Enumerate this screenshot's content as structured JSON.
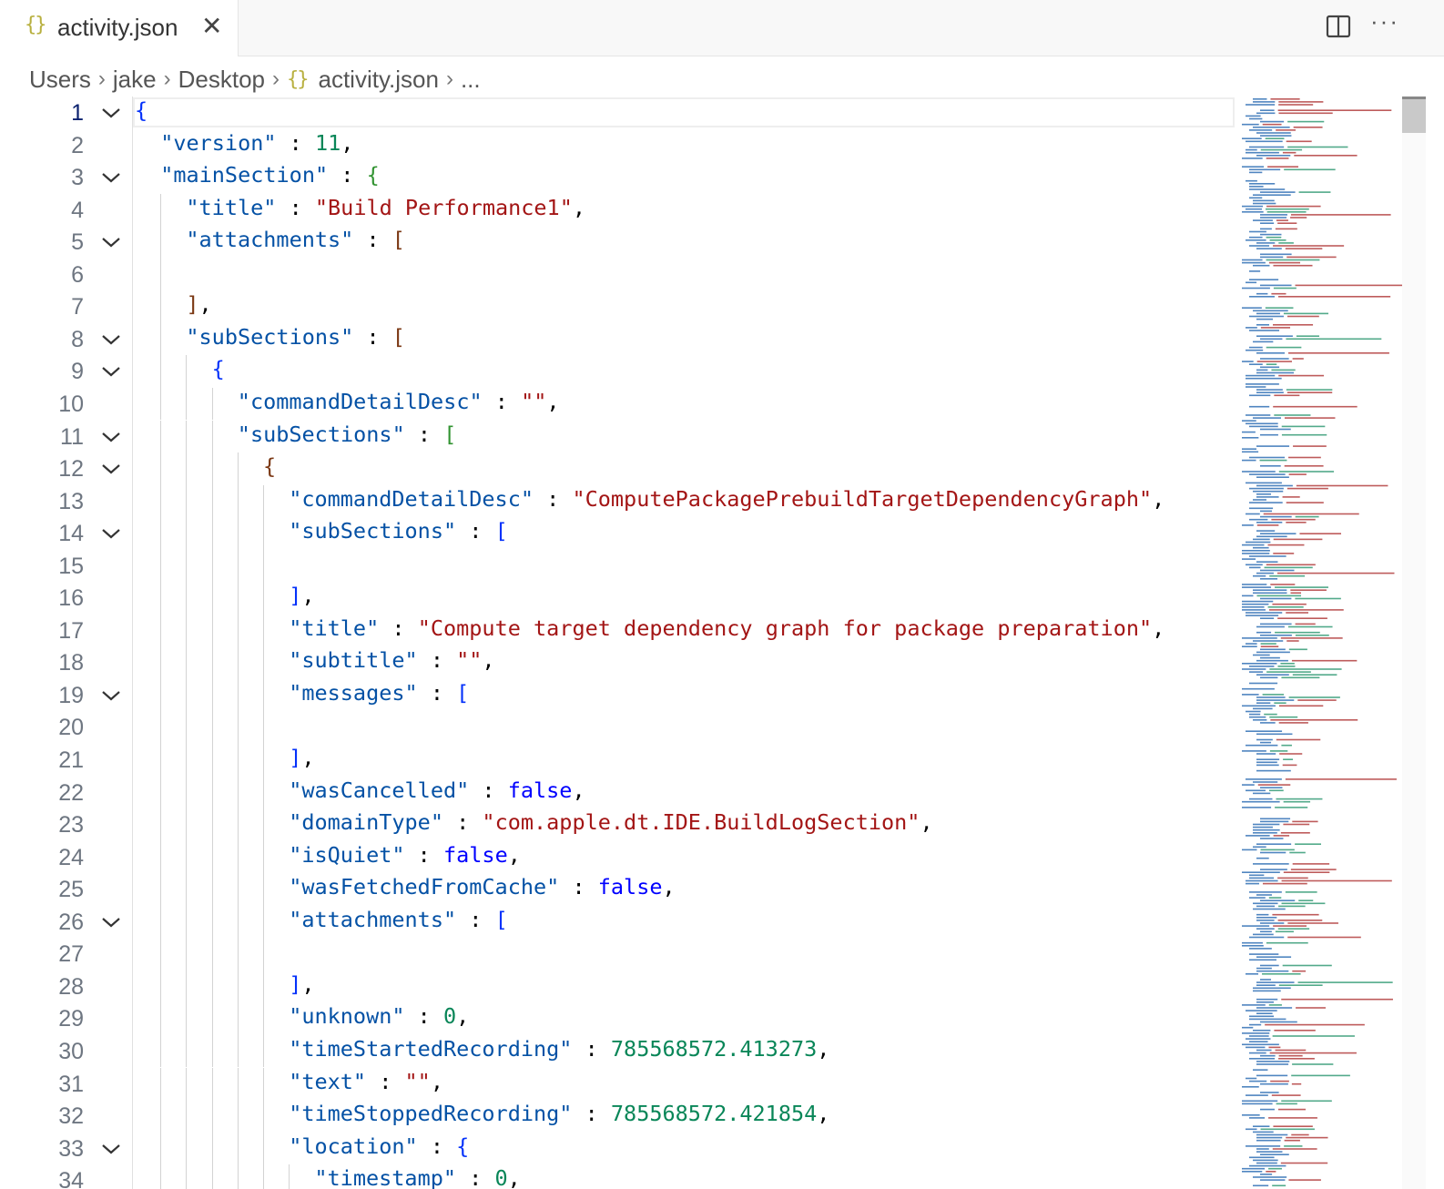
{
  "tab": {
    "label": "activity.json",
    "icon": "json-braces-icon"
  },
  "breadcrumb": {
    "items": [
      "Users",
      "jake",
      "Desktop",
      "activity.json",
      "..."
    ]
  },
  "editor": {
    "active_line": 1,
    "lines": [
      {
        "n": "1",
        "fold": true,
        "indent": 0,
        "tokens": [
          [
            "br1",
            "{"
          ]
        ]
      },
      {
        "n": "2",
        "fold": false,
        "indent": 1,
        "tokens": [
          [
            "k",
            "\"version\""
          ],
          [
            "p",
            " : "
          ],
          [
            "n",
            "11"
          ],
          [
            "p",
            ","
          ]
        ]
      },
      {
        "n": "3",
        "fold": true,
        "indent": 1,
        "tokens": [
          [
            "k",
            "\"mainSection\""
          ],
          [
            "p",
            " : "
          ],
          [
            "br2",
            "{"
          ]
        ]
      },
      {
        "n": "4",
        "fold": false,
        "indent": 2,
        "tokens": [
          [
            "k",
            "\"title\""
          ],
          [
            "p",
            " : "
          ],
          [
            "s",
            "\"Build Performance1\""
          ],
          [
            "p",
            ","
          ]
        ]
      },
      {
        "n": "5",
        "fold": true,
        "indent": 2,
        "tokens": [
          [
            "k",
            "\"attachments\""
          ],
          [
            "p",
            " : "
          ],
          [
            "br3",
            "["
          ]
        ]
      },
      {
        "n": "6",
        "fold": false,
        "indent": 2,
        "tokens": []
      },
      {
        "n": "7",
        "fold": false,
        "indent": 2,
        "tokens": [
          [
            "br3",
            "]"
          ],
          [
            "p",
            ","
          ]
        ]
      },
      {
        "n": "8",
        "fold": true,
        "indent": 2,
        "tokens": [
          [
            "k",
            "\"subSections\""
          ],
          [
            "p",
            " : "
          ],
          [
            "br3",
            "["
          ]
        ]
      },
      {
        "n": "9",
        "fold": true,
        "indent": 3,
        "tokens": [
          [
            "br1",
            "{"
          ]
        ]
      },
      {
        "n": "10",
        "fold": false,
        "indent": 4,
        "tokens": [
          [
            "k",
            "\"commandDetailDesc\""
          ],
          [
            "p",
            " : "
          ],
          [
            "s",
            "\"\""
          ],
          [
            "p",
            ","
          ]
        ]
      },
      {
        "n": "11",
        "fold": true,
        "indent": 4,
        "tokens": [
          [
            "k",
            "\"subSections\""
          ],
          [
            "p",
            " : "
          ],
          [
            "br2",
            "["
          ]
        ]
      },
      {
        "n": "12",
        "fold": true,
        "indent": 5,
        "tokens": [
          [
            "br3",
            "{"
          ]
        ]
      },
      {
        "n": "13",
        "fold": false,
        "indent": 6,
        "tokens": [
          [
            "k",
            "\"commandDetailDesc\""
          ],
          [
            "p",
            " : "
          ],
          [
            "s",
            "\"ComputePackagePrebuildTargetDependencyGraph\""
          ],
          [
            "p",
            ","
          ]
        ]
      },
      {
        "n": "14",
        "fold": true,
        "indent": 6,
        "tokens": [
          [
            "k",
            "\"subSections\""
          ],
          [
            "p",
            " : "
          ],
          [
            "br1",
            "["
          ]
        ]
      },
      {
        "n": "15",
        "fold": false,
        "indent": 6,
        "tokens": []
      },
      {
        "n": "16",
        "fold": false,
        "indent": 6,
        "tokens": [
          [
            "br1",
            "]"
          ],
          [
            "p",
            ","
          ]
        ]
      },
      {
        "n": "17",
        "fold": false,
        "indent": 6,
        "tokens": [
          [
            "k",
            "\"title\""
          ],
          [
            "p",
            " : "
          ],
          [
            "s",
            "\"Compute target dependency graph for package preparation\""
          ],
          [
            "p",
            ","
          ]
        ]
      },
      {
        "n": "18",
        "fold": false,
        "indent": 6,
        "tokens": [
          [
            "k",
            "\"subtitle\""
          ],
          [
            "p",
            " : "
          ],
          [
            "s",
            "\"\""
          ],
          [
            "p",
            ","
          ]
        ]
      },
      {
        "n": "19",
        "fold": true,
        "indent": 6,
        "tokens": [
          [
            "k",
            "\"messages\""
          ],
          [
            "p",
            " : "
          ],
          [
            "br1",
            "["
          ]
        ]
      },
      {
        "n": "20",
        "fold": false,
        "indent": 6,
        "tokens": []
      },
      {
        "n": "21",
        "fold": false,
        "indent": 6,
        "tokens": [
          [
            "br1",
            "]"
          ],
          [
            "p",
            ","
          ]
        ]
      },
      {
        "n": "22",
        "fold": false,
        "indent": 6,
        "tokens": [
          [
            "k",
            "\"wasCancelled\""
          ],
          [
            "p",
            " : "
          ],
          [
            "b",
            "false"
          ],
          [
            "p",
            ","
          ]
        ]
      },
      {
        "n": "23",
        "fold": false,
        "indent": 6,
        "tokens": [
          [
            "k",
            "\"domainType\""
          ],
          [
            "p",
            " : "
          ],
          [
            "s",
            "\"com.apple.dt.IDE.BuildLogSection\""
          ],
          [
            "p",
            ","
          ]
        ]
      },
      {
        "n": "24",
        "fold": false,
        "indent": 6,
        "tokens": [
          [
            "k",
            "\"isQuiet\""
          ],
          [
            "p",
            " : "
          ],
          [
            "b",
            "false"
          ],
          [
            "p",
            ","
          ]
        ]
      },
      {
        "n": "25",
        "fold": false,
        "indent": 6,
        "tokens": [
          [
            "k",
            "\"wasFetchedFromCache\""
          ],
          [
            "p",
            " : "
          ],
          [
            "b",
            "false"
          ],
          [
            "p",
            ","
          ]
        ]
      },
      {
        "n": "26",
        "fold": true,
        "indent": 6,
        "tokens": [
          [
            "k",
            "\"attachments\""
          ],
          [
            "p",
            " : "
          ],
          [
            "br1",
            "["
          ]
        ]
      },
      {
        "n": "27",
        "fold": false,
        "indent": 6,
        "tokens": []
      },
      {
        "n": "28",
        "fold": false,
        "indent": 6,
        "tokens": [
          [
            "br1",
            "]"
          ],
          [
            "p",
            ","
          ]
        ]
      },
      {
        "n": "29",
        "fold": false,
        "indent": 6,
        "tokens": [
          [
            "k",
            "\"unknown\""
          ],
          [
            "p",
            " : "
          ],
          [
            "n",
            "0"
          ],
          [
            "p",
            ","
          ]
        ]
      },
      {
        "n": "30",
        "fold": false,
        "indent": 6,
        "tokens": [
          [
            "k",
            "\"timeStartedRecording\""
          ],
          [
            "p",
            " : "
          ],
          [
            "n",
            "785568572.413273"
          ],
          [
            "p",
            ","
          ]
        ]
      },
      {
        "n": "31",
        "fold": false,
        "indent": 6,
        "tokens": [
          [
            "k",
            "\"text\""
          ],
          [
            "p",
            " : "
          ],
          [
            "s",
            "\"\""
          ],
          [
            "p",
            ","
          ]
        ]
      },
      {
        "n": "32",
        "fold": false,
        "indent": 6,
        "tokens": [
          [
            "k",
            "\"timeStoppedRecording\""
          ],
          [
            "p",
            " : "
          ],
          [
            "n",
            "785568572.421854"
          ],
          [
            "p",
            ","
          ]
        ]
      },
      {
        "n": "33",
        "fold": true,
        "indent": 6,
        "tokens": [
          [
            "k",
            "\"location\""
          ],
          [
            "p",
            " : "
          ],
          [
            "br1",
            "{"
          ]
        ]
      },
      {
        "n": "34",
        "fold": false,
        "indent": 7,
        "tokens": [
          [
            "k",
            "\"timestamp\""
          ],
          [
            "p",
            " : "
          ],
          [
            "n",
            "0"
          ],
          [
            "p",
            ","
          ]
        ]
      }
    ]
  },
  "colors": {
    "key": "#0451a5",
    "string": "#a31515",
    "number": "#098658",
    "boolean": "#0000ff"
  }
}
